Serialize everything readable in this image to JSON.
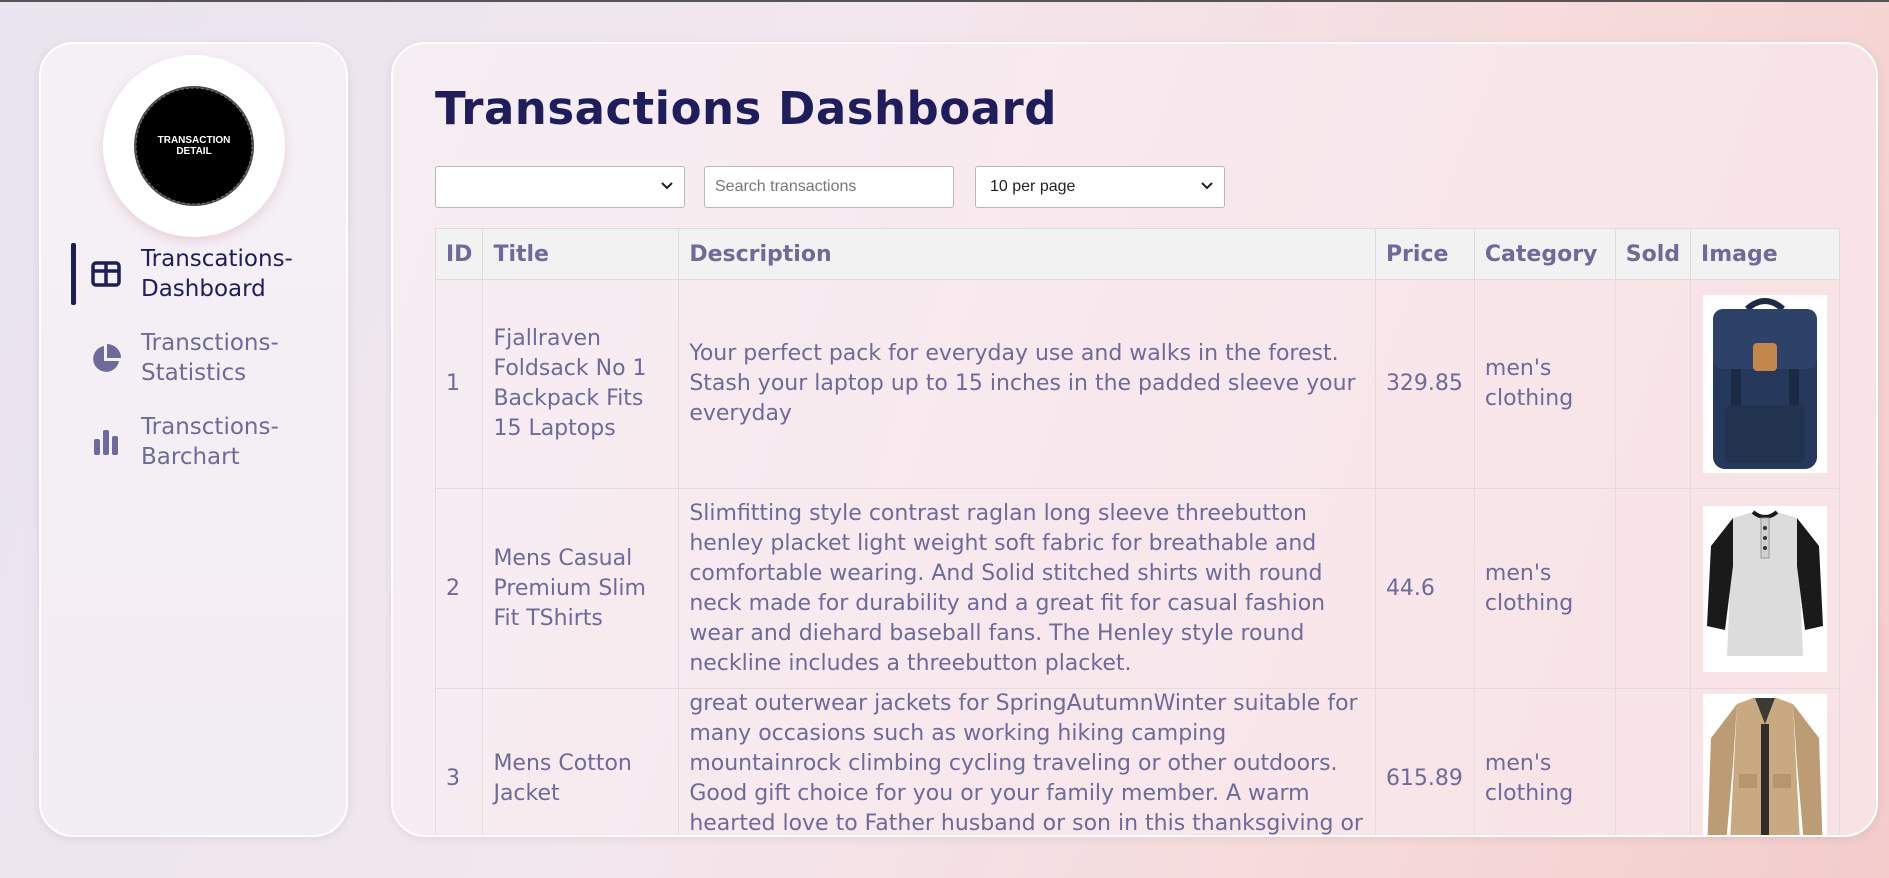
{
  "logo": {
    "line1": "TRANSACTION",
    "line2": "DETAIL"
  },
  "sidebar": {
    "items": [
      {
        "label": "Transcations-\nDashboard",
        "icon": "layout-icon",
        "active": true
      },
      {
        "label": "Transctions-\nStatistics",
        "icon": "pie-chart-icon",
        "active": false
      },
      {
        "label": "Transctions-\nBarchart",
        "icon": "bar-chart-icon",
        "active": false
      }
    ]
  },
  "main": {
    "title": "Transactions Dashboard",
    "month_select": {
      "value": ""
    },
    "search": {
      "placeholder": "Search transactions",
      "value": ""
    },
    "per_page_select": {
      "value": "10 per page"
    }
  },
  "table": {
    "columns": [
      "ID",
      "Title",
      "Description",
      "Price",
      "Category",
      "Sold",
      "Image"
    ],
    "rows": [
      {
        "id": "1",
        "title": "Fjallraven Foldsack No 1 Backpack Fits 15 Laptops",
        "description": "Your perfect pack for everyday use and walks in the forest. Stash your laptop up to 15 inches in the padded sleeve your everyday",
        "price": "329.85",
        "category": "men's clothing",
        "sold": "",
        "image": "navy-backpack"
      },
      {
        "id": "2",
        "title": "Mens Casual Premium Slim Fit TShirts",
        "description": "Slimfitting style contrast raglan long sleeve threebutton henley placket light weight soft fabric for breathable and comfortable wearing. And Solid stitched shirts with round neck made for durability and a great fit for casual fashion wear and diehard baseball fans. The Henley style round neckline includes a threebutton placket.",
        "price": "44.6",
        "category": "men's clothing",
        "sold": "",
        "image": "raglan-henley-shirt"
      },
      {
        "id": "3",
        "title": "Mens Cotton Jacket",
        "description": "great outerwear jackets for SpringAutumnWinter suitable for many occasions such as working hiking camping mountainrock climbing cycling traveling or other outdoors. Good gift choice for you or your family member. A warm hearted love to Father husband or son in this thanksgiving or Christmas Day.",
        "price": "615.89",
        "category": "men's clothing",
        "sold": "",
        "image": "khaki-cotton-jacket"
      }
    ]
  },
  "colors": {
    "accent": "#1f1d5c",
    "text_muted": "#6e6a9a"
  }
}
